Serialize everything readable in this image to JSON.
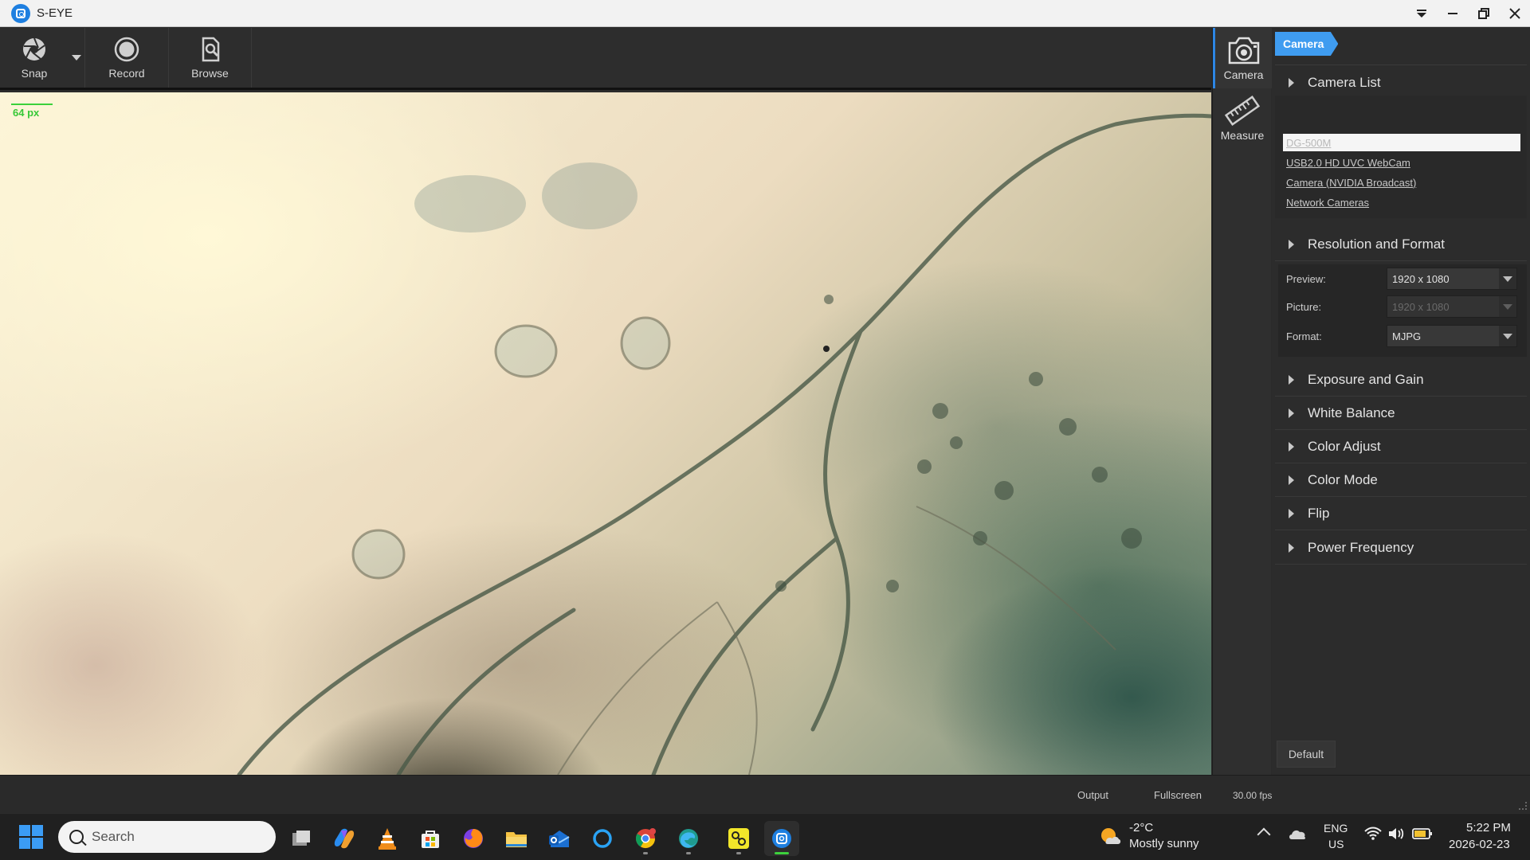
{
  "window": {
    "title": "S-EYE"
  },
  "toolbar": {
    "snap_label": "Snap",
    "record_label": "Record",
    "browse_label": "Browse"
  },
  "viewport": {
    "scale_label": "64 px"
  },
  "vtabs": {
    "camera_label": "Camera",
    "measure_label": "Measure"
  },
  "panel": {
    "tab_label": "Camera",
    "camera_list_title": "Camera List",
    "cameras": [
      "DG-500M",
      "USB2.0 HD UVC WebCam",
      "Camera (NVIDIA Broadcast)",
      "Network Cameras"
    ],
    "selected_camera": "DG-500M",
    "resolution_title": "Resolution and Format",
    "preview_label": "Preview:",
    "preview_value": "1920 x 1080",
    "picture_label": "Picture:",
    "picture_value": "1920 x 1080",
    "format_label": "Format:",
    "format_value": "MJPG",
    "sections": [
      "Exposure and Gain",
      "White Balance",
      "Color Adjust",
      "Color Mode",
      "Flip",
      "Power Frequency"
    ],
    "default_label": "Default"
  },
  "status": {
    "output_label": "Output",
    "fullscreen_label": "Fullscreen",
    "fps": "30.00 fps"
  },
  "taskbar": {
    "search_placeholder": "Search",
    "weather_temp": "-2°C",
    "weather_desc": "Mostly sunny",
    "lang": "ENG",
    "region": "US",
    "time": "5:22 PM",
    "date": "2026-02-23",
    "apps": [
      "task-view",
      "copilot",
      "vlc",
      "microsoft-store",
      "firefox",
      "file-explorer",
      "outlook",
      "cortana",
      "chrome",
      "edge",
      "yellow-app",
      "s-eye"
    ]
  },
  "colors": {
    "accent": "#3f9cf0",
    "scale_bar": "#3bd13b",
    "panel_bg": "#2c2c2c"
  }
}
